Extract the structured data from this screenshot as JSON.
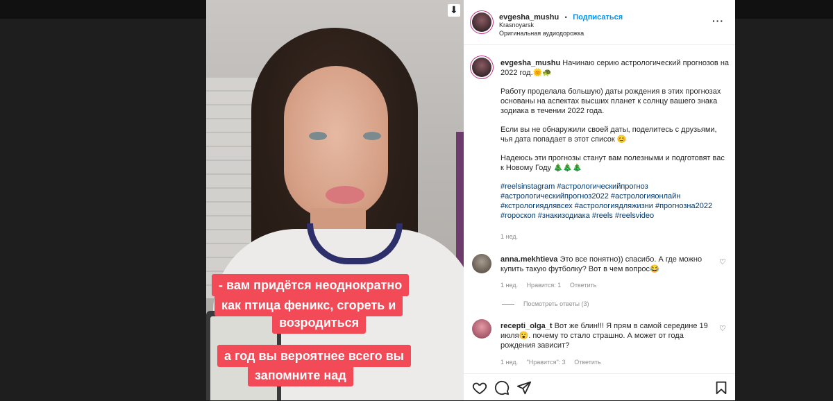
{
  "post": {
    "author": "evgesha_mushu",
    "follow_label": "Подписаться",
    "location": "Krasnoyarsk",
    "audio": "Оригинальная аудиодорожка",
    "more_label": "···",
    "caption_line1": "Начинаю серию астрологический прогнозов на 2022 год.🌞🐢",
    "caption_p2": "Работу проделала большую) даты рождения в этих прогнозах основаны на аспектах высших планет к солнцу вашего знака зодиака в течении 2022 года.",
    "caption_p3": "Если вы не обнаружили своей даты, поделитесь с друзьями, чья дата попадает в этот список 😊",
    "caption_p4": "Надеюсь эти прогнозы станут вам полезными и подготовят вас к Новому Году 🎄🎄🎄",
    "hashtags": "#reelsinstagram #астрологическийпрогноз #астрологическийпрогноз2022 #астрологияонлайн #кстрологиядлявсех #астрологиядляжизни #прогнозна2022 #гороскоп #знакизодиака #reels #reelsvideo",
    "time": "1 нед."
  },
  "video_captions": {
    "line1": "- вам придётся неоднократно",
    "line2": "как птица феникс, сгореть и",
    "line3": "возродиться",
    "line4": "а год вы вероятнее всего вы",
    "line5": "запомните над"
  },
  "comments": [
    {
      "user": "anna.mekhtieva",
      "text": "Это все понятно)) спасибо. А где можно купить такую футболку? Вот в чем вопрос😂",
      "time": "1 нед.",
      "likes": "Нравится: 1",
      "reply": "Ответить",
      "view_replies": "Посмотреть ответы (3)"
    },
    {
      "user": "recepti_olga_t",
      "text": "Вот же блин!!! Я прям в самой середине 19 июля😮. почему то стало страшно. А может от года рождения зависит?",
      "time": "1 нед.",
      "likes": "\"Нравится\": 3",
      "reply": "Ответить"
    }
  ],
  "icons": [
    "download-icon",
    "heart-icon",
    "comment-icon",
    "share-icon",
    "bookmark-icon",
    "more-icon"
  ],
  "colors": {
    "accent": "#0095f6",
    "caption_bg": "#f24a56",
    "link": "#00376b"
  }
}
